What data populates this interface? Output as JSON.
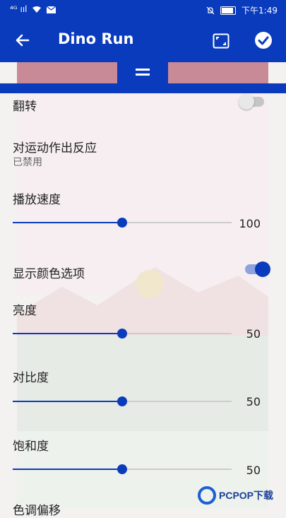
{
  "status_bar": {
    "signal": "⁴ᴳ ııl",
    "time": "下午1:49"
  },
  "app_bar": {
    "title": "Dino Run"
  },
  "settings": {
    "flip_label": "翻转",
    "react_label": "对运动作出反应",
    "react_status": "已禁用",
    "speed_label": "播放速度",
    "speed_value": "100",
    "show_color_label": "显示颜色选项",
    "brightness_label": "亮度",
    "brightness_value": "50",
    "contrast_label": "对比度",
    "contrast_value": "50",
    "saturation_label": "饱和度",
    "saturation_value": "50",
    "partial_label": "色调偏移"
  },
  "watermark": {
    "text": "PCPOP下载"
  },
  "colors": {
    "accent": "#0a3bbd",
    "track": "#cccccc"
  },
  "icons": [
    "back-arrow-icon",
    "fit-screen-icon",
    "checkmark-icon",
    "drag-handle-icon",
    "wifi-icon",
    "mail-icon",
    "bell-off-icon",
    "battery-icon"
  ]
}
